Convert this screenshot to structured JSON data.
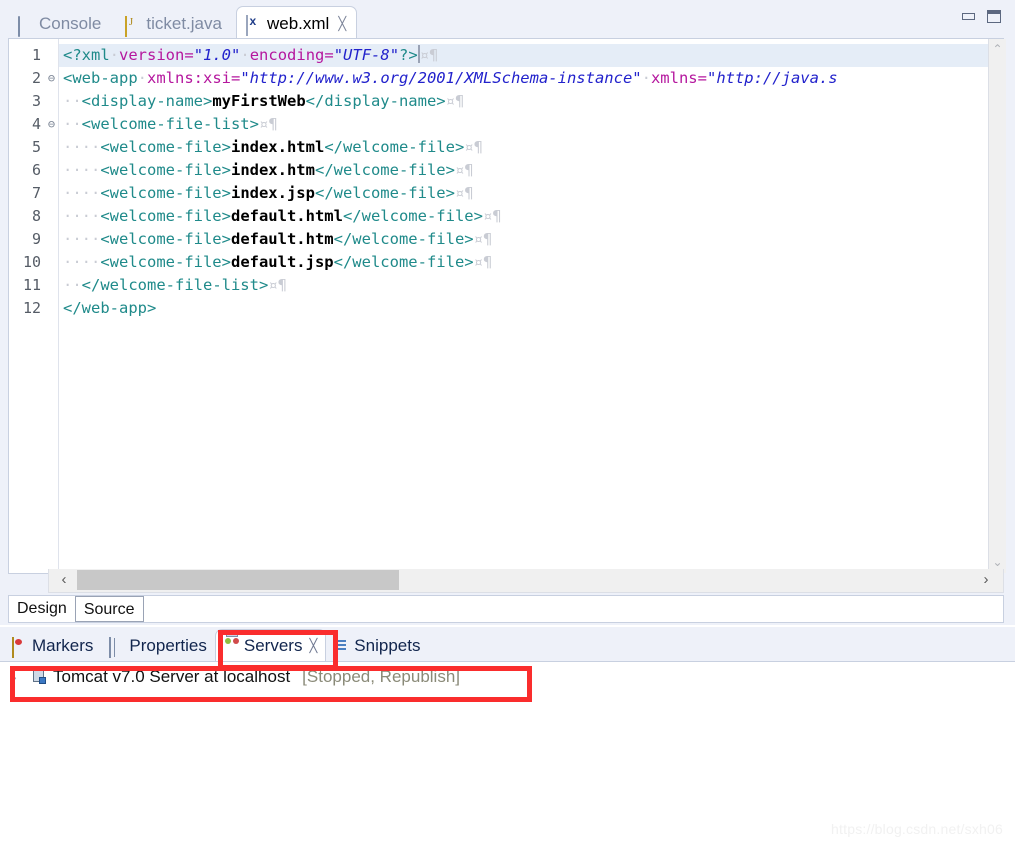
{
  "window": {
    "minimize_label": "Minimize",
    "maximize_label": "Maximize"
  },
  "editor": {
    "tabs": [
      {
        "label": "Console",
        "icon": "console-icon",
        "active": false,
        "closable": false
      },
      {
        "label": "ticket.java",
        "icon": "java-file-icon",
        "active": false,
        "closable": false
      },
      {
        "label": "web.xml",
        "icon": "xml-file-icon",
        "active": true,
        "closable": true,
        "close_glyph": "╳"
      }
    ],
    "bottom_tabs": [
      {
        "label": "Design",
        "selected": false
      },
      {
        "label": "Source",
        "selected": true
      }
    ],
    "scroll": {
      "up_arrow": "⌃",
      "down_arrow": "⌄",
      "left_arrow": "‹",
      "right_arrow": "›"
    },
    "code": {
      "filename": "web.xml",
      "lines": [
        {
          "num": "1",
          "fold": "",
          "highlighted": true,
          "tokens": [
            {
              "t": "<?xml",
              "c": "tok-punct"
            },
            {
              "t": "·",
              "c": "tok-ws"
            },
            {
              "t": "version",
              "c": "tok-attr"
            },
            {
              "t": "=",
              "c": "tok-attr"
            },
            {
              "t": "\"1.0\"",
              "c": "tok-val"
            },
            {
              "t": "·",
              "c": "tok-ws"
            },
            {
              "t": "encoding",
              "c": "tok-attr"
            },
            {
              "t": "=",
              "c": "tok-attr"
            },
            {
              "t": "\"UTF-8\"",
              "c": "tok-val"
            },
            {
              "t": "?>",
              "c": "tok-punct"
            },
            {
              "t": "¤¶",
              "c": "tok-pilc"
            }
          ]
        },
        {
          "num": "2",
          "fold": "⊖",
          "highlighted": false,
          "tokens": [
            {
              "t": "<web-app",
              "c": "tok-punct"
            },
            {
              "t": "·",
              "c": "tok-ws"
            },
            {
              "t": "xmlns:xsi",
              "c": "tok-attr"
            },
            {
              "t": "=",
              "c": "tok-attr"
            },
            {
              "t": "\"http://www.w3.org/2001/XMLSchema-instance\"",
              "c": "tok-val"
            },
            {
              "t": "·",
              "c": "tok-ws"
            },
            {
              "t": "xmlns",
              "c": "tok-attr"
            },
            {
              "t": "=",
              "c": "tok-attr"
            },
            {
              "t": "\"http://java.s",
              "c": "tok-val"
            }
          ]
        },
        {
          "num": "3",
          "fold": "",
          "highlighted": false,
          "tokens": [
            {
              "t": "··",
              "c": "tok-ws"
            },
            {
              "t": "<display-name>",
              "c": "tok-punct"
            },
            {
              "t": "myFirstWeb",
              "c": "tok-text"
            },
            {
              "t": "</display-name>",
              "c": "tok-punct"
            },
            {
              "t": "¤¶",
              "c": "tok-pilc"
            }
          ]
        },
        {
          "num": "4",
          "fold": "⊖",
          "highlighted": false,
          "tokens": [
            {
              "t": "··",
              "c": "tok-ws"
            },
            {
              "t": "<welcome-file-list>",
              "c": "tok-punct"
            },
            {
              "t": "¤¶",
              "c": "tok-pilc"
            }
          ]
        },
        {
          "num": "5",
          "fold": "",
          "highlighted": false,
          "tokens": [
            {
              "t": "····",
              "c": "tok-ws"
            },
            {
              "t": "<welcome-file>",
              "c": "tok-punct"
            },
            {
              "t": "index.html",
              "c": "tok-text"
            },
            {
              "t": "</welcome-file>",
              "c": "tok-punct"
            },
            {
              "t": "¤¶",
              "c": "tok-pilc"
            }
          ]
        },
        {
          "num": "6",
          "fold": "",
          "highlighted": false,
          "tokens": [
            {
              "t": "····",
              "c": "tok-ws"
            },
            {
              "t": "<welcome-file>",
              "c": "tok-punct"
            },
            {
              "t": "index.htm",
              "c": "tok-text"
            },
            {
              "t": "</welcome-file>",
              "c": "tok-punct"
            },
            {
              "t": "¤¶",
              "c": "tok-pilc"
            }
          ]
        },
        {
          "num": "7",
          "fold": "",
          "highlighted": false,
          "tokens": [
            {
              "t": "····",
              "c": "tok-ws"
            },
            {
              "t": "<welcome-file>",
              "c": "tok-punct"
            },
            {
              "t": "index.jsp",
              "c": "tok-text"
            },
            {
              "t": "</welcome-file>",
              "c": "tok-punct"
            },
            {
              "t": "¤¶",
              "c": "tok-pilc"
            }
          ]
        },
        {
          "num": "8",
          "fold": "",
          "highlighted": false,
          "tokens": [
            {
              "t": "····",
              "c": "tok-ws"
            },
            {
              "t": "<welcome-file>",
              "c": "tok-punct"
            },
            {
              "t": "default.html",
              "c": "tok-text"
            },
            {
              "t": "</welcome-file>",
              "c": "tok-punct"
            },
            {
              "t": "¤¶",
              "c": "tok-pilc"
            }
          ]
        },
        {
          "num": "9",
          "fold": "",
          "highlighted": false,
          "tokens": [
            {
              "t": "····",
              "c": "tok-ws"
            },
            {
              "t": "<welcome-file>",
              "c": "tok-punct"
            },
            {
              "t": "default.htm",
              "c": "tok-text"
            },
            {
              "t": "</welcome-file>",
              "c": "tok-punct"
            },
            {
              "t": "¤¶",
              "c": "tok-pilc"
            }
          ]
        },
        {
          "num": "10",
          "fold": "",
          "highlighted": false,
          "tokens": [
            {
              "t": "····",
              "c": "tok-ws"
            },
            {
              "t": "<welcome-file>",
              "c": "tok-punct"
            },
            {
              "t": "default.jsp",
              "c": "tok-text"
            },
            {
              "t": "</welcome-file>",
              "c": "tok-punct"
            },
            {
              "t": "¤¶",
              "c": "tok-pilc"
            }
          ]
        },
        {
          "num": "11",
          "fold": "",
          "highlighted": false,
          "tokens": [
            {
              "t": "··",
              "c": "tok-ws"
            },
            {
              "t": "</welcome-file-list>",
              "c": "tok-punct"
            },
            {
              "t": "¤¶",
              "c": "tok-pilc"
            }
          ]
        },
        {
          "num": "12",
          "fold": "",
          "highlighted": false,
          "tokens": [
            {
              "t": "</web-app>",
              "c": "tok-punct"
            }
          ]
        }
      ]
    }
  },
  "bottom_view": {
    "tabs": [
      {
        "label": "Markers",
        "icon": "markers-icon",
        "active": false,
        "closable": false
      },
      {
        "label": "Properties",
        "icon": "properties-icon",
        "active": false,
        "closable": false
      },
      {
        "label": "Servers",
        "icon": "servers-icon",
        "active": true,
        "closable": true,
        "close_glyph": "╳"
      },
      {
        "label": "Snippets",
        "icon": "snippets-icon",
        "active": false,
        "closable": false
      }
    ],
    "servers": {
      "rows": [
        {
          "twisty": "›",
          "icon": "tomcat-server-icon",
          "name": "Tomcat v7.0 Server at localhost",
          "status": "[Stopped, Republish]"
        }
      ]
    }
  },
  "annotations": {
    "highlight_color": "#fa2d2d",
    "boxes": [
      {
        "name": "servers-tab-highlight"
      },
      {
        "name": "server-row-highlight"
      }
    ]
  },
  "watermark": {
    "text": "https://blog.csdn.net/sxh06"
  }
}
